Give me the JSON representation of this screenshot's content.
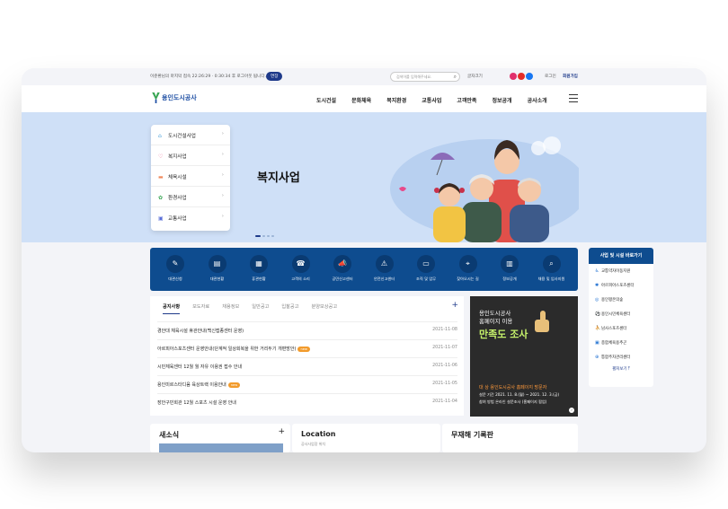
{
  "topbar": {
    "login_text": "이준환님의 마지막 접속 22:26:29 · 0:30:34 후 로그아웃 됩니다.",
    "extend": "연장",
    "search_placeholder": "검색어를 입력해주세요.",
    "font_size": "글자크기",
    "login": "로그인",
    "join": "회원가입"
  },
  "header": {
    "logo_text": "용인도시공사",
    "nav": [
      "도시건설",
      "문화체육",
      "복지환경",
      "교통사업",
      "고객만족",
      "정보공개",
      "공사소개"
    ]
  },
  "hero": {
    "title": "복지사업",
    "submenu": [
      "도시건설사업",
      "복지사업",
      "체육시설",
      "환경사업",
      "교통사업"
    ]
  },
  "quick_links": [
    "대관신청",
    "대관현황",
    "휴관현황",
    "고객의 소리",
    "공민신고센터",
    "안전신고센터",
    "조직 및 업무",
    "찾아오시는 길",
    "정보공개",
    "채용 및 입사지원"
  ],
  "news": {
    "tabs": [
      "공지사항",
      "보도자료",
      "채용정보",
      "일반공고",
      "입찰공고",
      "분양보상공고"
    ],
    "items": [
      {
        "title": "경안대 체육시설 휴관안내(백신접종센터 운영)",
        "date": "2021-11-08",
        "new": ""
      },
      {
        "title": "아르피아스포츠센터 운영안내(단계적 일상회복을 위한 거리두기 개편방안)",
        "date": "2021-11-07",
        "new": "new"
      },
      {
        "title": "시민체육센터 12월 월 자유 이용권 접수 안내",
        "date": "2021-11-06",
        "new": ""
      },
      {
        "title": "용인미르스타디움 육상트랙 이용안내",
        "date": "2021-11-05",
        "new": "new"
      },
      {
        "title": "장안구민회관 12월 스포츠 시설 운영 안내",
        "date": "2021-11-04",
        "new": ""
      }
    ]
  },
  "banner": {
    "line1": "용인도시공사",
    "line2": "홈페이지 이용",
    "line3": "만족도 조사",
    "period_label": "대    상   용인도시공사 홈페이지 방문자",
    "period": "설문 기간   2021. 11. 8.(월) ~ 2021. 12. 3.(금)",
    "method": "참여 방법   온라인 설문조사 (홈페이지 팝업)"
  },
  "shortcut": {
    "title": "사업 및 시설 바로가기",
    "items": [
      "교통약자이동지원",
      "아르피아스포츠센터",
      "용인평온의숲",
      "용인시민체육센터",
      "남사스포츠센터",
      "종합체육용추곤",
      "통합주차관리센터"
    ],
    "more": "펼쳐보기"
  },
  "bottom": {
    "news_title": "새소식",
    "location_title": "Location",
    "location_sub": "공사사업장 위치",
    "safety_title": "무재해 기록판"
  }
}
